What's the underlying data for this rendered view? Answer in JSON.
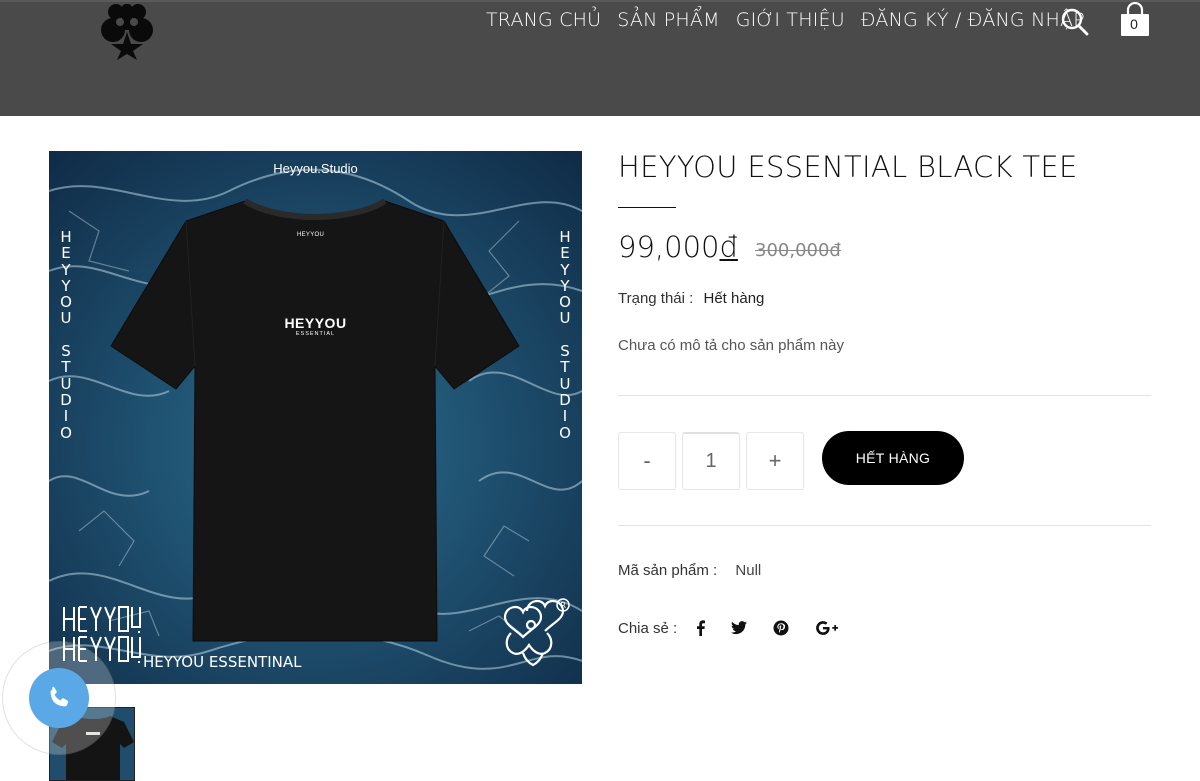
{
  "header": {
    "nav": [
      {
        "label": "TRANG CHỦ"
      },
      {
        "label": "SẢN PHẨM"
      },
      {
        "label": "GIỚI THIỆU"
      },
      {
        "label": "ĐĂNG KÝ / ĐĂNG NHẬP"
      }
    ],
    "cart_count": "0",
    "icons": [
      "logo",
      "search-icon",
      "cart-icon"
    ]
  },
  "image": {
    "watermark": "Heyyou.Studio",
    "side_text": "HEYYOU STUDIO",
    "shirt_brand": "HEYYOU",
    "shirt_sub": "ESSENTIAL",
    "neck_label": "HEYYOU",
    "bottom_brand": "HEYYOU ESSENTINAL"
  },
  "product": {
    "title": "HEYYOU ESSENTIAL BLACK TEE",
    "price": "99,000",
    "currency": "đ",
    "old_price": "300,000đ",
    "status_label": "Trạng thái :",
    "status_value": "Hết hàng",
    "description": "Chưa có mô tả cho sản phẩm này",
    "qty_minus": "-",
    "qty_value": "1",
    "qty_plus": "+",
    "buy_label": "HẾT HÀNG",
    "sku_label": "Mã sản phẩm :",
    "sku_value": "Null",
    "share_label": "Chia sẻ :",
    "share_icons": [
      "facebook-icon",
      "twitter-icon",
      "pinterest-icon",
      "google-plus-icon"
    ]
  },
  "colors": {
    "header_bg": "#4a4a4a",
    "button_bg": "#000000",
    "call_button": "#5aa9e6"
  }
}
